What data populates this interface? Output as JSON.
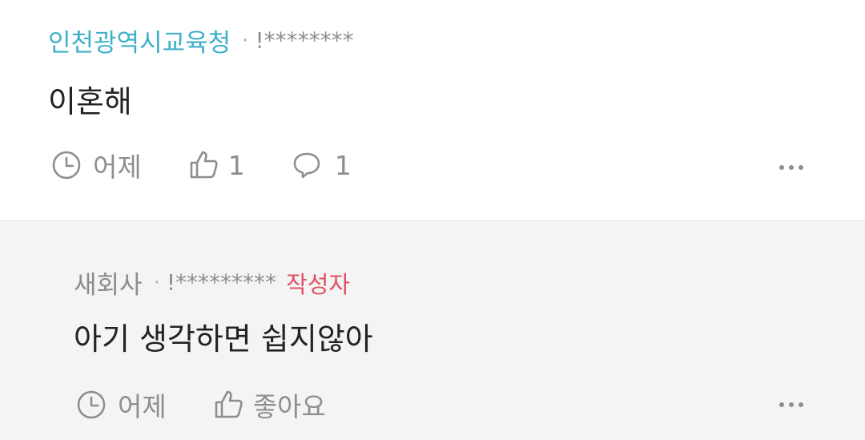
{
  "comments": [
    {
      "author": "인천광역시교육청",
      "separator": "·",
      "masked_id": "!********",
      "text": "이혼해",
      "time": "어제",
      "likes": "1",
      "replies": "1"
    },
    {
      "author": "새회사",
      "separator": "·",
      "masked_id": "!*********",
      "op_badge": "작성자",
      "text": "아기 생각하면 쉽지않아",
      "time": "어제",
      "like_label": "좋아요"
    }
  ],
  "colors": {
    "author_link": "#3fb0c9",
    "op_badge": "#e05263",
    "meta_gray": "#8e8e8e",
    "reply_bg": "#f4f4f4"
  },
  "icons": [
    "clock-icon",
    "thumbs-up-icon",
    "speech-bubble-icon",
    "more-options-icon"
  ]
}
